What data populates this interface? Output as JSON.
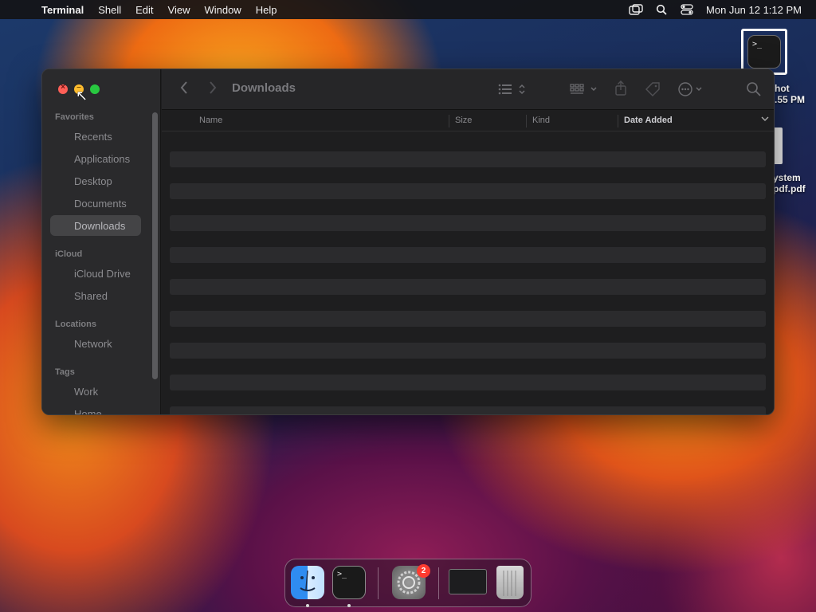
{
  "menubar": {
    "apple_icon": "apple-icon",
    "app_name": "Terminal",
    "items": [
      "Shell",
      "Edit",
      "View",
      "Window",
      "Help"
    ],
    "clock": "Mon Jun 12  1:12 PM",
    "status_icons": [
      "screen-mirroring-icon",
      "spotlight-search-icon",
      "control-center-icon"
    ]
  },
  "desktop": {
    "terminal_icon_text": ">_",
    "items": [
      {
        "label_line1": "hot",
        "label_line2": ".55 PM"
      },
      {
        "label_line1": "ystem",
        "label_line2": "pdf.pdf"
      }
    ]
  },
  "finder": {
    "title": "Downloads",
    "sidebar": {
      "favorites_header": "Favorites",
      "favorites": [
        "Recents",
        "Applications",
        "Desktop",
        "Documents",
        "Downloads"
      ],
      "active_item": "Downloads",
      "icloud_header": "iCloud",
      "icloud": [
        "iCloud Drive",
        "Shared"
      ],
      "locations_header": "Locations",
      "locations": [
        "Network"
      ],
      "tags_header": "Tags",
      "tags": [
        "Work",
        "Home"
      ]
    },
    "columns": {
      "name": "Name",
      "size": "Size",
      "kind": "Kind",
      "date_added": "Date Added"
    },
    "row_count": 9
  },
  "dock": {
    "apps": [
      "finder",
      "terminal",
      "system-settings",
      "window-preview",
      "trash"
    ],
    "settings_badge": "2"
  },
  "colors": {
    "close": "#ff5f57",
    "minimize": "#febc2e",
    "zoom": "#28c840",
    "badge": "#ff3b30"
  }
}
